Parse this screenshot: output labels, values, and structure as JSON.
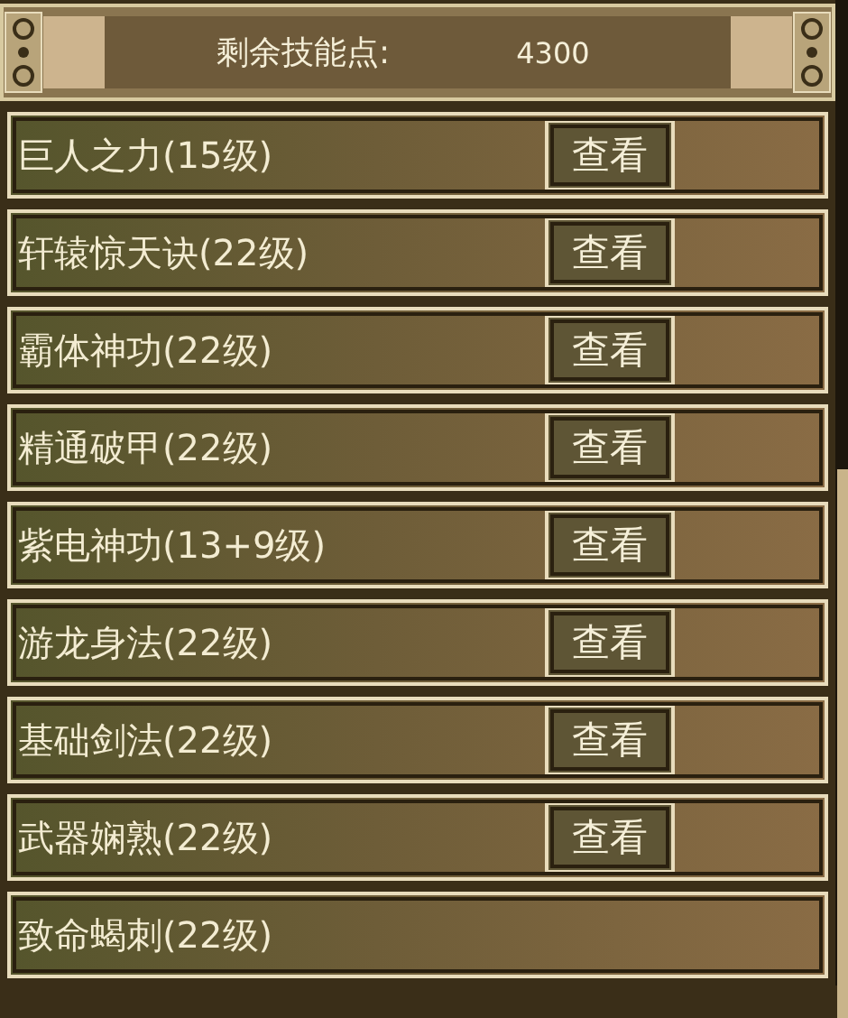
{
  "header": {
    "label": "剩余技能点:",
    "value": "4300"
  },
  "skills": [
    {
      "name": "巨人之力(15级)",
      "button": "查看"
    },
    {
      "name": "轩辕惊天诀(22级)",
      "button": "查看"
    },
    {
      "name": "霸体神功(22级)",
      "button": "查看"
    },
    {
      "name": "精通破甲(22级)",
      "button": "查看"
    },
    {
      "name": "紫电神功(13+9级)",
      "button": "查看"
    },
    {
      "name": "游龙身法(22级)",
      "button": "查看"
    },
    {
      "name": "基础剑法(22级)",
      "button": "查看"
    },
    {
      "name": "武器娴熟(22级)",
      "button": "查看"
    },
    {
      "name": "致命蝎刺(22级)"
    }
  ]
}
